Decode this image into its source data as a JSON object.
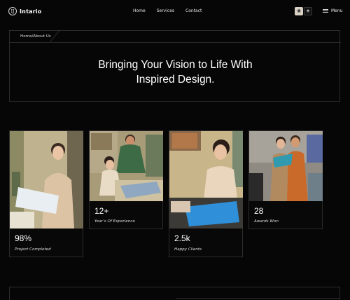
{
  "brand": {
    "mark": "IJ",
    "name": "Intario"
  },
  "nav": {
    "links": [
      "Home",
      "Services",
      "Contact"
    ],
    "light_icon": "sun-icon",
    "dark_icon": "sun-outline-icon",
    "menu_label": "Menu"
  },
  "breadcrumb": {
    "home": "Home",
    "separator": "/",
    "current": "About Us"
  },
  "hero": {
    "title_line1": "Bringing Your Vision to Life With",
    "title_line2": "Inspired Design."
  },
  "stats": [
    {
      "value": "98%",
      "label": "Project Completed"
    },
    {
      "value": "12+",
      "label": "Year’s Of Experience"
    },
    {
      "value": "2.5k",
      "label": "Happy Clients"
    },
    {
      "value": "28",
      "label": "Awards Won"
    }
  ],
  "colors": {
    "background": "#060606",
    "border": "#2c2c2c",
    "text": "#ffffff"
  }
}
